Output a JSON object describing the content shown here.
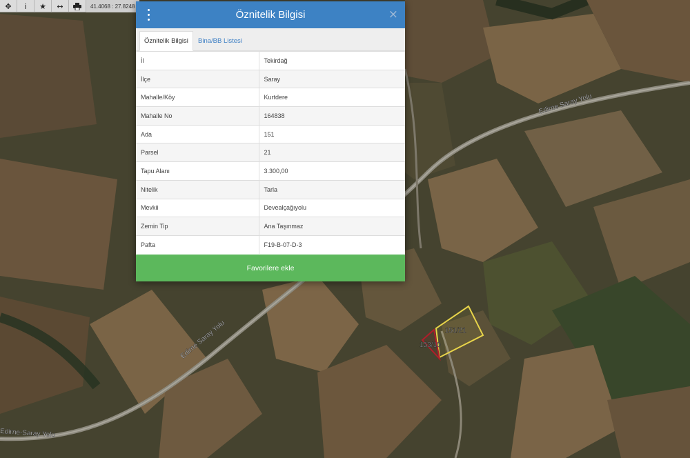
{
  "toolbar": {
    "icons": [
      "move-icon",
      "info-icon",
      "star-icon",
      "measure-icon",
      "print-icon"
    ],
    "coordinates": "41.4068 : 27.8248"
  },
  "map": {
    "road_label_1": "Edirne Saray Yolu",
    "road_label_2": "Edirne Saray Yolu",
    "road_label_3": "Edirne-Saray Yolu",
    "parcel_selected_label": "151/21",
    "parcel_neighbor_label": "153/10",
    "colors": {
      "selected_parcel": "#e8d44a",
      "neighbor_parcel": "#b01d2a"
    }
  },
  "modal": {
    "title": "Öznitelik Bilgisi",
    "close_symbol": "×",
    "tabs": [
      {
        "label": "Öznitelik Bilgisi",
        "active": true
      },
      {
        "label": "Bina/BB Listesi",
        "active": false
      }
    ],
    "rows": [
      {
        "key": "İl",
        "value": "Tekirdağ"
      },
      {
        "key": "İlçe",
        "value": "Saray"
      },
      {
        "key": "Mahalle/Köy",
        "value": "Kurtdere"
      },
      {
        "key": "Mahalle No",
        "value": "164838"
      },
      {
        "key": "Ada",
        "value": "151"
      },
      {
        "key": "Parsel",
        "value": "21"
      },
      {
        "key": "Tapu Alanı",
        "value": "3.300,00"
      },
      {
        "key": "Nitelik",
        "value": "Tarla"
      },
      {
        "key": "Mevkii",
        "value": "Devealçağıyolu"
      },
      {
        "key": "Zemin Tip",
        "value": "Ana Taşınmaz"
      },
      {
        "key": "Pafta",
        "value": "F19-B-07-D-3"
      }
    ],
    "favorite_button": "Favorilere ekle",
    "colors": {
      "header": "#3d82c4",
      "button": "#5cb85c"
    }
  }
}
